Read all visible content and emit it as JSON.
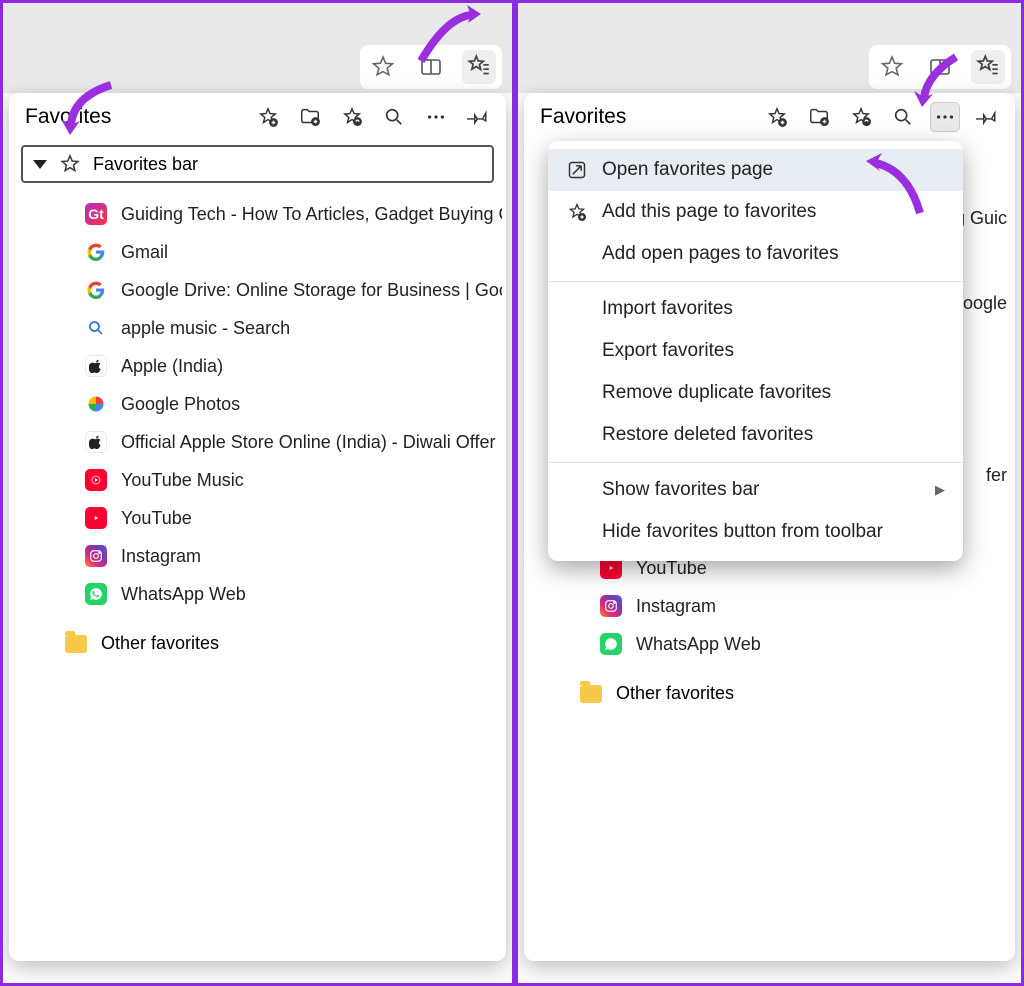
{
  "panel": {
    "title": "Favorites",
    "bar_label": "Favorites bar",
    "other_label": "Other favorites",
    "items": [
      {
        "label": "Guiding Tech - How To Articles, Gadget Buying Guide",
        "icon": "gt"
      },
      {
        "label": "Gmail",
        "icon": "g"
      },
      {
        "label": "Google Drive: Online Storage for Business | Google",
        "icon": "g"
      },
      {
        "label": "apple music - Search",
        "icon": "search"
      },
      {
        "label": "Apple (India)",
        "icon": "apple"
      },
      {
        "label": "Google Photos",
        "icon": "photos"
      },
      {
        "label": "Official Apple Store Online (India) - Diwali Offer",
        "icon": "apple"
      },
      {
        "label": "YouTube Music",
        "icon": "ytm"
      },
      {
        "label": "YouTube",
        "icon": "yt"
      },
      {
        "label": "Instagram",
        "icon": "ig"
      },
      {
        "label": "WhatsApp Web",
        "icon": "wa"
      }
    ]
  },
  "panel_right": {
    "title": "Favorites",
    "other_label": "Other favorites",
    "visible_items": [
      {
        "label": "g Guic",
        "icon": "none"
      },
      {
        "label": "ioogle",
        "icon": "none"
      },
      {
        "label": "fer",
        "icon": "none"
      },
      {
        "label": "YouTube",
        "icon": "yt"
      },
      {
        "label": "Instagram",
        "icon": "ig"
      },
      {
        "label": "WhatsApp Web",
        "icon": "wa"
      }
    ]
  },
  "context_menu": {
    "items": [
      {
        "label": "Open favorites page",
        "icon": "open",
        "highlight": true
      },
      {
        "label": "Add this page to favorites",
        "icon": "star-plus"
      },
      {
        "label": "Add open pages to favorites",
        "icon": ""
      },
      {
        "sep": true
      },
      {
        "label": "Import favorites",
        "icon": ""
      },
      {
        "label": "Export favorites",
        "icon": ""
      },
      {
        "label": "Remove duplicate favorites",
        "icon": ""
      },
      {
        "label": "Restore deleted favorites",
        "icon": ""
      },
      {
        "sep": true
      },
      {
        "label": "Show favorites bar",
        "icon": "",
        "submenu": true
      },
      {
        "label": "Hide favorites button from toolbar",
        "icon": ""
      }
    ]
  }
}
